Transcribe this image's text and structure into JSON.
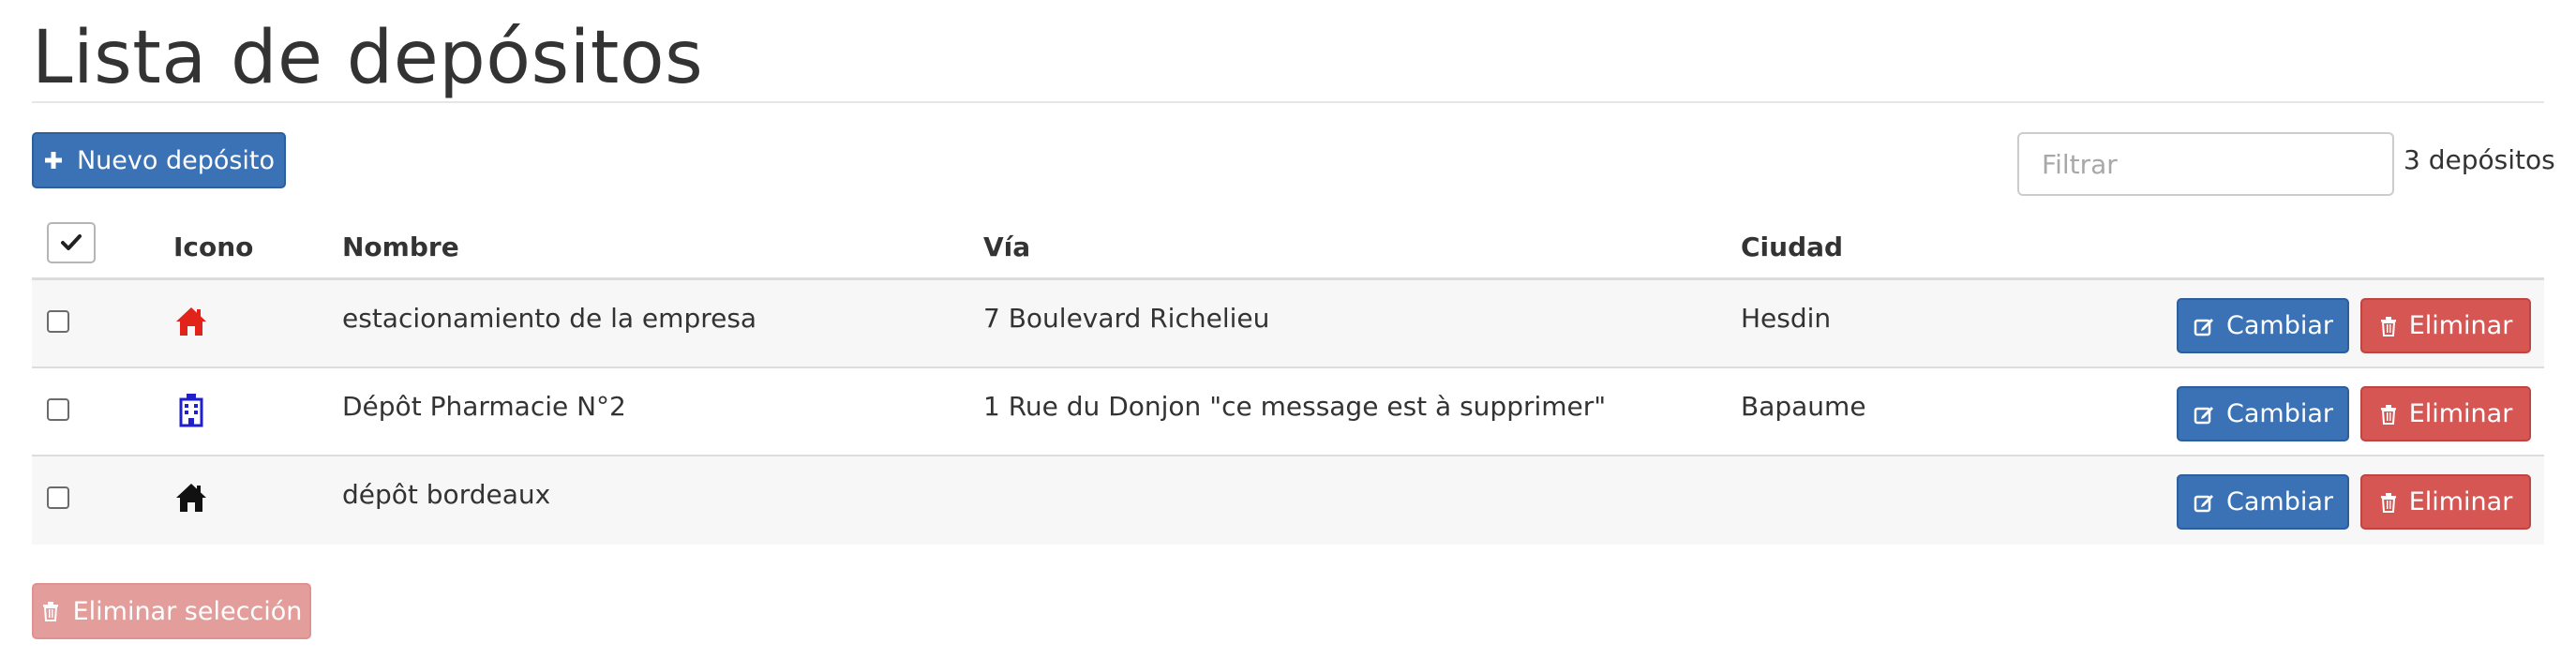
{
  "page": {
    "title": "Lista de depósitos"
  },
  "toolbar": {
    "new_label": "Nuevo depósito",
    "filter_placeholder": "Filtrar",
    "count_text": "3 depósitos"
  },
  "table": {
    "columns": [
      "Icono",
      "Nombre",
      "Vía",
      "Ciudad"
    ],
    "rows": [
      {
        "icon": "home-icon",
        "icon_color": "#e2231a",
        "name": "estacionamiento de la empresa",
        "via": "7 Boulevard Richelieu",
        "city": "Hesdin"
      },
      {
        "icon": "hospital-icon",
        "icon_color": "#1f1fcc",
        "name": "Dépôt Pharmacie N°2",
        "via": "1 Rue du Donjon \"ce message est à supprimer\"",
        "city": "Bapaume"
      },
      {
        "icon": "home-icon",
        "icon_color": "#111111",
        "name": "dépôt bordeaux",
        "via": "",
        "city": ""
      }
    ],
    "edit_label": "Cambiar",
    "delete_label": "Eliminar"
  },
  "footer": {
    "bulk_delete_label": "Eliminar selección"
  },
  "colors": {
    "primary": "#3a72b5",
    "danger": "#d55653",
    "danger_disabled": "#e39d9b"
  }
}
